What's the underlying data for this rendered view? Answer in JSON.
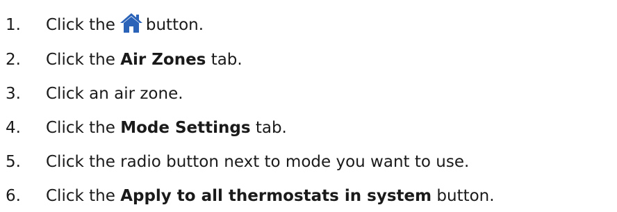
{
  "steps": [
    {
      "number": "1.",
      "before": "Click the",
      "icon": "home-icon",
      "after": "button."
    },
    {
      "number": "2.",
      "before": "Click the",
      "bold": "Air Zones",
      "after": "tab."
    },
    {
      "number": "3.",
      "text": "Click an air zone."
    },
    {
      "number": "4.",
      "before": "Click the",
      "bold": "Mode Settings",
      "after": "tab."
    },
    {
      "number": "5.",
      "text": "Click the radio button next to mode you want to use."
    },
    {
      "number": "6.",
      "before": "Click the",
      "bold": "Apply to all thermostats in system",
      "after": "button."
    }
  ],
  "colors": {
    "home_icon": "#2b63b8",
    "text": "#1a1a1a"
  }
}
